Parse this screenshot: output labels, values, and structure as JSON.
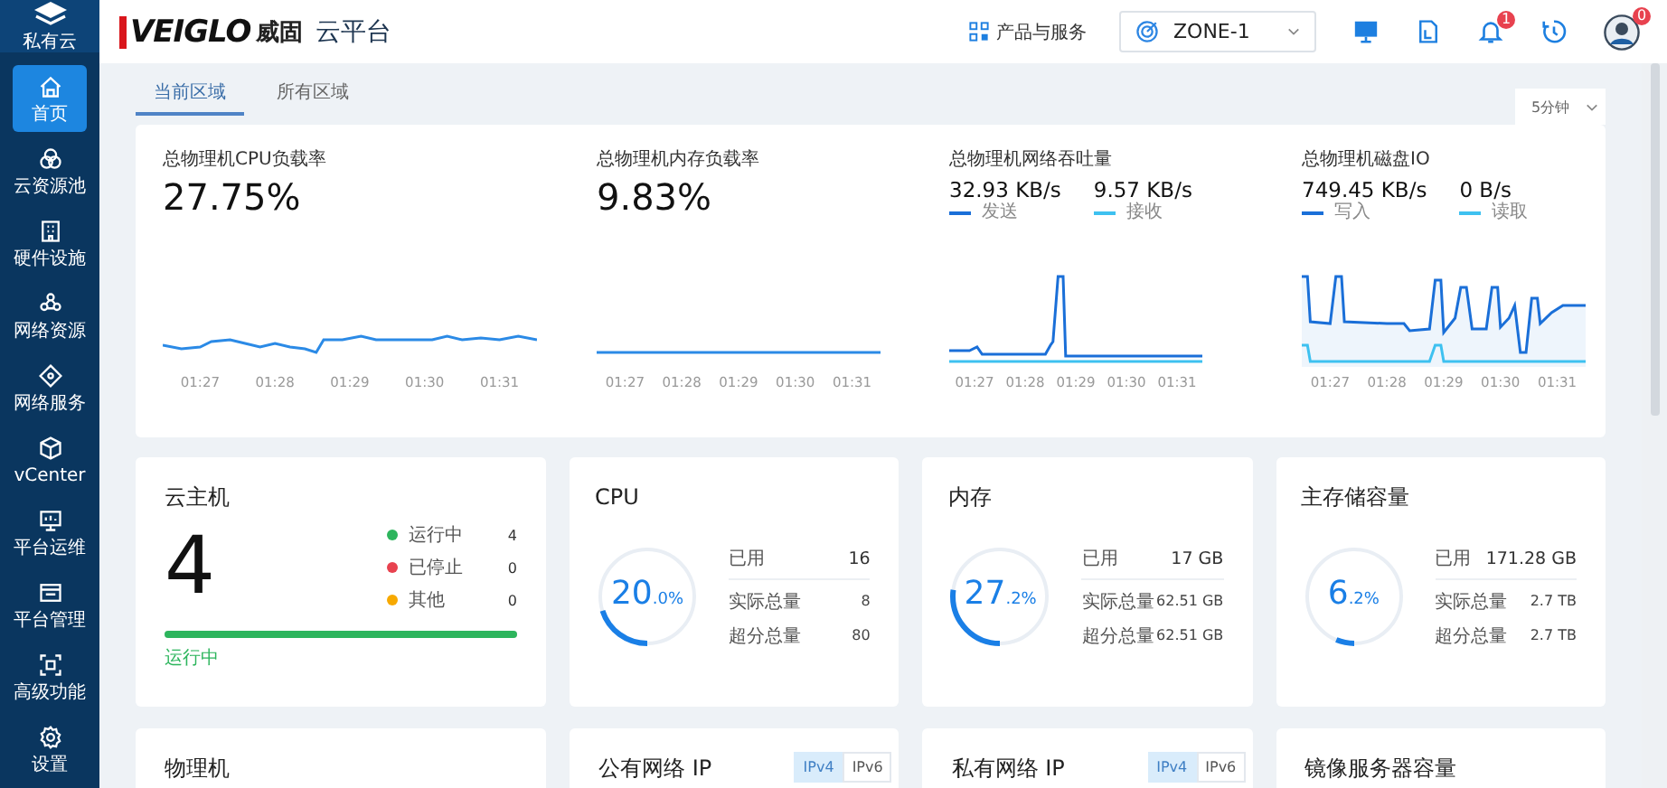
{
  "sidebar": {
    "brand": "私有云",
    "items": [
      {
        "label": "首页",
        "selected": true
      },
      {
        "label": "云资源池",
        "selected": false
      },
      {
        "label": "硬件设施",
        "selected": false
      },
      {
        "label": "网络资源",
        "selected": false
      },
      {
        "label": "网络服务",
        "selected": false
      },
      {
        "label": "vCenter",
        "selected": false
      },
      {
        "label": "平台运维",
        "selected": false
      },
      {
        "label": "平台管理",
        "selected": false
      },
      {
        "label": "高级功能",
        "selected": false
      },
      {
        "label": "设置",
        "selected": false
      }
    ]
  },
  "header": {
    "logo": {
      "mark": "VEIGLO",
      "name_cn": "威固",
      "product": "云平台"
    },
    "products": "产品与服务",
    "zone": {
      "value": "ZONE-1"
    },
    "notifications": {
      "badge": "1"
    },
    "avatar": {
      "badge": "0"
    }
  },
  "region_tabs": [
    {
      "label": "当前区域",
      "selected": true
    },
    {
      "label": "所有区域",
      "selected": false
    }
  ],
  "interval": {
    "value": "5分钟"
  },
  "metrics": [
    {
      "kind": "single",
      "title": "总物理机CPU负载率",
      "value": "27.75%",
      "times": [
        "01:27",
        "01:28",
        "01:29",
        "01:30",
        "01:31"
      ]
    },
    {
      "kind": "single",
      "title": "总物理机内存负载率",
      "value": "9.83%",
      "times": [
        "01:27",
        "01:28",
        "01:29",
        "01:30",
        "01:31"
      ]
    },
    {
      "kind": "pair",
      "title": "总物理机网络吞吐量",
      "readings": [
        {
          "value": "32.93 KB/s",
          "label": "发送",
          "color": "#1a6fd8"
        },
        {
          "value": "9.57 KB/s",
          "label": "接收",
          "color": "#3ec1f0"
        }
      ],
      "times": [
        "01:27",
        "01:28",
        "01:29",
        "01:30",
        "01:31"
      ]
    },
    {
      "kind": "pair",
      "title": "总物理机磁盘IO",
      "readings": [
        {
          "value": "749.45 KB/s",
          "label": "写入",
          "color": "#1a6fd8"
        },
        {
          "value": "0 B/s",
          "label": "读取",
          "color": "#3ec1f0"
        }
      ],
      "times": [
        "01:27",
        "01:28",
        "01:29",
        "01:30",
        "01:31"
      ]
    }
  ],
  "vm": {
    "title": "云主机",
    "count": "4",
    "statuses": [
      {
        "label": "运行中",
        "count": "4",
        "color": "#2db55d"
      },
      {
        "label": "已停止",
        "count": "0",
        "color": "#e8424f"
      },
      {
        "label": "其他",
        "count": "0",
        "color": "#f7a900"
      }
    ],
    "bar": {
      "level": 1,
      "label": "运行中"
    }
  },
  "resources": [
    {
      "title": "CPU",
      "percent": "20",
      "fraction": ".0%",
      "level": 0.2,
      "rows": [
        {
          "label": "已用",
          "value": "16"
        },
        {
          "label": "实际总量",
          "value": "8"
        },
        {
          "label": "超分总量",
          "value": "80"
        }
      ]
    },
    {
      "title": "内存",
      "percent": "27",
      "fraction": ".2%",
      "level": 0.272,
      "rows": [
        {
          "label": "已用",
          "value": "17 GB"
        },
        {
          "label": "实际总量",
          "value": "62.51 GB"
        },
        {
          "label": "超分总量",
          "value": "62.51 GB"
        }
      ]
    },
    {
      "title": "主存储容量",
      "percent": "6",
      "fraction": ".2%",
      "level": 0.062,
      "rows": [
        {
          "label": "已用",
          "value": "171.28 GB"
        },
        {
          "label": "实际总量",
          "value": "2.7 TB"
        },
        {
          "label": "超分总量",
          "value": "2.7 TB"
        }
      ]
    }
  ],
  "lower_cards": [
    {
      "title": "物理机"
    },
    {
      "title": "公有网络 IP",
      "versions": [
        {
          "label": "IPv4",
          "selected": true
        },
        {
          "label": "IPv6",
          "selected": false
        }
      ]
    },
    {
      "title": "私有网络 IP",
      "versions": [
        {
          "label": "IPv4",
          "selected": true
        },
        {
          "label": "IPv6",
          "selected": false
        }
      ]
    },
    {
      "title": "镜像服务器容量"
    }
  ]
}
